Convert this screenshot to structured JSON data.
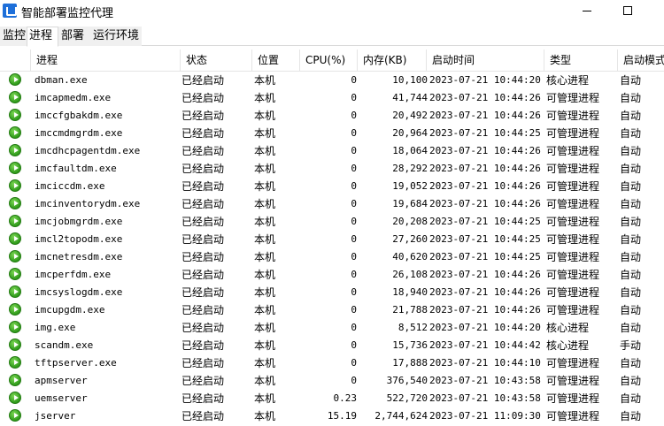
{
  "window": {
    "title": "智能部署监控代理"
  },
  "tabs": [
    {
      "label": "监控"
    },
    {
      "label": "进程"
    },
    {
      "label": "部署"
    },
    {
      "label": "运行环境"
    }
  ],
  "active_tab": "进程",
  "columns": [
    "进程",
    "状态",
    "位置",
    "CPU(%)",
    "内存(KB)",
    "启动时间",
    "类型",
    "启动模式"
  ],
  "rows": [
    {
      "name": "dbman.exe",
      "state": "已经启动",
      "location": "本机",
      "cpu": "0",
      "memory": "10,100",
      "start_time": "2023-07-21 10:44:20",
      "type": "核心进程",
      "mode": "自动"
    },
    {
      "name": "imcapmedm.exe",
      "state": "已经启动",
      "location": "本机",
      "cpu": "0",
      "memory": "41,744",
      "start_time": "2023-07-21 10:44:26",
      "type": "可管理进程",
      "mode": "自动"
    },
    {
      "name": "imccfgbakdm.exe",
      "state": "已经启动",
      "location": "本机",
      "cpu": "0",
      "memory": "20,492",
      "start_time": "2023-07-21 10:44:26",
      "type": "可管理进程",
      "mode": "自动"
    },
    {
      "name": "imccmdmgrdm.exe",
      "state": "已经启动",
      "location": "本机",
      "cpu": "0",
      "memory": "20,964",
      "start_time": "2023-07-21 10:44:25",
      "type": "可管理进程",
      "mode": "自动"
    },
    {
      "name": "imcdhcpagentdm.exe",
      "state": "已经启动",
      "location": "本机",
      "cpu": "0",
      "memory": "18,064",
      "start_time": "2023-07-21 10:44:26",
      "type": "可管理进程",
      "mode": "自动"
    },
    {
      "name": "imcfaultdm.exe",
      "state": "已经启动",
      "location": "本机",
      "cpu": "0",
      "memory": "28,292",
      "start_time": "2023-07-21 10:44:26",
      "type": "可管理进程",
      "mode": "自动"
    },
    {
      "name": "imciccdm.exe",
      "state": "已经启动",
      "location": "本机",
      "cpu": "0",
      "memory": "19,052",
      "start_time": "2023-07-21 10:44:26",
      "type": "可管理进程",
      "mode": "自动"
    },
    {
      "name": "imcinventorydm.exe",
      "state": "已经启动",
      "location": "本机",
      "cpu": "0",
      "memory": "19,684",
      "start_time": "2023-07-21 10:44:26",
      "type": "可管理进程",
      "mode": "自动"
    },
    {
      "name": "imcjobmgrdm.exe",
      "state": "已经启动",
      "location": "本机",
      "cpu": "0",
      "memory": "20,208",
      "start_time": "2023-07-21 10:44:25",
      "type": "可管理进程",
      "mode": "自动"
    },
    {
      "name": "imcl2topodm.exe",
      "state": "已经启动",
      "location": "本机",
      "cpu": "0",
      "memory": "27,260",
      "start_time": "2023-07-21 10:44:25",
      "type": "可管理进程",
      "mode": "自动"
    },
    {
      "name": "imcnetresdm.exe",
      "state": "已经启动",
      "location": "本机",
      "cpu": "0",
      "memory": "40,620",
      "start_time": "2023-07-21 10:44:25",
      "type": "可管理进程",
      "mode": "自动"
    },
    {
      "name": "imcperfdm.exe",
      "state": "已经启动",
      "location": "本机",
      "cpu": "0",
      "memory": "26,108",
      "start_time": "2023-07-21 10:44:26",
      "type": "可管理进程",
      "mode": "自动"
    },
    {
      "name": "imcsyslogdm.exe",
      "state": "已经启动",
      "location": "本机",
      "cpu": "0",
      "memory": "18,940",
      "start_time": "2023-07-21 10:44:26",
      "type": "可管理进程",
      "mode": "自动"
    },
    {
      "name": "imcupgdm.exe",
      "state": "已经启动",
      "location": "本机",
      "cpu": "0",
      "memory": "21,788",
      "start_time": "2023-07-21 10:44:26",
      "type": "可管理进程",
      "mode": "自动"
    },
    {
      "name": "img.exe",
      "state": "已经启动",
      "location": "本机",
      "cpu": "0",
      "memory": "8,512",
      "start_time": "2023-07-21 10:44:20",
      "type": "核心进程",
      "mode": "自动"
    },
    {
      "name": "scandm.exe",
      "state": "已经启动",
      "location": "本机",
      "cpu": "0",
      "memory": "15,736",
      "start_time": "2023-07-21 10:44:42",
      "type": "核心进程",
      "mode": "手动"
    },
    {
      "name": "tftpserver.exe",
      "state": "已经启动",
      "location": "本机",
      "cpu": "0",
      "memory": "17,888",
      "start_time": "2023-07-21 10:44:10",
      "type": "可管理进程",
      "mode": "自动"
    },
    {
      "name": "apmserver",
      "state": "已经启动",
      "location": "本机",
      "cpu": "0",
      "memory": "376,540",
      "start_time": "2023-07-21 10:43:58",
      "type": "可管理进程",
      "mode": "自动"
    },
    {
      "name": "uemserver",
      "state": "已经启动",
      "location": "本机",
      "cpu": "0.23",
      "memory": "522,720",
      "start_time": "2023-07-21 10:43:58",
      "type": "可管理进程",
      "mode": "自动"
    },
    {
      "name": "jserver",
      "state": "已经启动",
      "location": "本机",
      "cpu": "15.19",
      "memory": "2,744,624",
      "start_time": "2023-07-21 11:09:30",
      "type": "可管理进程",
      "mode": "自动"
    }
  ]
}
